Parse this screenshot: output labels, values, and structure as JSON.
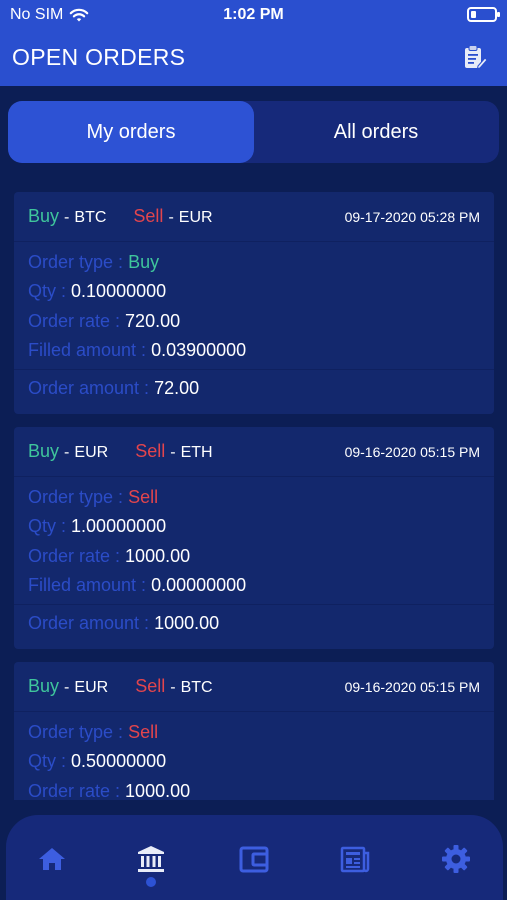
{
  "status_bar": {
    "carrier": "No SIM",
    "time": "1:02 PM"
  },
  "header": {
    "title": "OPEN ORDERS",
    "icon": "clipboard-edit-icon"
  },
  "tabs": [
    {
      "label": "My orders",
      "active": true
    },
    {
      "label": "All orders",
      "active": false
    }
  ],
  "labels": {
    "order_type": "Order type :",
    "qty": "Qty :",
    "order_rate": "Order rate :",
    "filled_amount": "Filled amount :",
    "order_amount": "Order amount :",
    "buy": "Buy",
    "sell": "Sell",
    "dash": "-"
  },
  "orders": [
    {
      "buy_currency": "BTC",
      "sell_currency": "EUR",
      "date": "09-17-2020 05:28 PM",
      "order_type": "Buy",
      "qty": "0.10000000",
      "order_rate": "720.00",
      "filled_amount": "0.03900000",
      "order_amount": "72.00"
    },
    {
      "buy_currency": "EUR",
      "sell_currency": "ETH",
      "date": "09-16-2020 05:15 PM",
      "order_type": "Sell",
      "qty": "1.00000000",
      "order_rate": "1000.00",
      "filled_amount": "0.00000000",
      "order_amount": "1000.00"
    },
    {
      "buy_currency": "EUR",
      "sell_currency": "BTC",
      "date": "09-16-2020 05:15 PM",
      "order_type": "Sell",
      "qty": "0.50000000",
      "order_rate": "1000.00"
    }
  ],
  "tab_bar": {
    "items": [
      "home-icon",
      "bank-icon",
      "wallet-icon",
      "news-icon",
      "settings-icon"
    ],
    "active_index": 1
  },
  "colors": {
    "buy": "#3fc59c",
    "sell": "#e2454d",
    "accent": "#2d52d4",
    "background": "#0c1e55"
  }
}
